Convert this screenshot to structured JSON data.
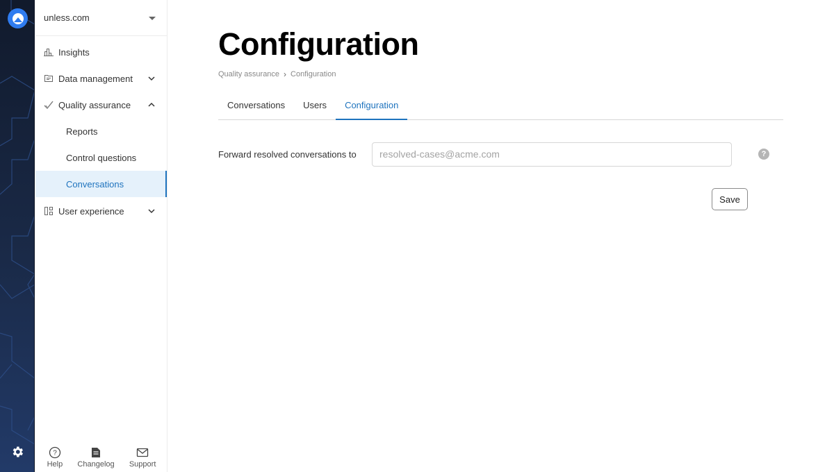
{
  "rail": {
    "logo_icon": "app-logo-icon",
    "settings_icon": "gear-icon"
  },
  "sidebar": {
    "org": {
      "name": "unless.com",
      "icon": "caret-down-icon"
    },
    "items": [
      {
        "label": "Insights",
        "icon": "bar-chart-icon",
        "expandable": false
      },
      {
        "label": "Data management",
        "icon": "folder-icon",
        "expandable": true,
        "expanded": false
      },
      {
        "label": "Quality assurance",
        "icon": "checkmark-icon",
        "expandable": true,
        "expanded": true,
        "children": [
          {
            "label": "Reports",
            "active": false
          },
          {
            "label": "Control questions",
            "active": false
          },
          {
            "label": "Conversations",
            "active": true
          }
        ]
      },
      {
        "label": "User experience",
        "icon": "layout-icon",
        "expandable": true,
        "expanded": false
      }
    ],
    "footer": [
      {
        "label": "Help",
        "icon": "help-circle-icon"
      },
      {
        "label": "Changelog",
        "icon": "document-icon"
      },
      {
        "label": "Support",
        "icon": "mail-icon"
      }
    ]
  },
  "main": {
    "title": "Configuration",
    "breadcrumb": [
      "Quality assurance",
      "Configuration"
    ],
    "breadcrumb_separator": "›",
    "tabs": [
      {
        "label": "Conversations",
        "active": false
      },
      {
        "label": "Users",
        "active": false
      },
      {
        "label": "Configuration",
        "active": true
      }
    ],
    "form": {
      "label": "Forward resolved conversations to",
      "value": "",
      "placeholder": "resolved-cases@acme.com",
      "help_glyph": "?"
    },
    "save_label": "Save"
  },
  "colors": {
    "accent": "#1e73be",
    "active_bg": "#e5f1fb",
    "rail_bg": "#1a2a48",
    "logo": "#2f7cf0"
  }
}
